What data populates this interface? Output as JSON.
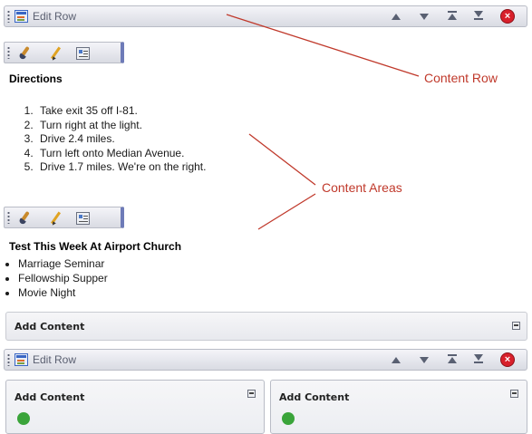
{
  "rows": [
    {
      "label": "Edit Row"
    },
    {
      "label": "Edit Row"
    }
  ],
  "content_areas": [
    {
      "heading": "Directions",
      "items": [
        "Take exit 35 off I-81.",
        "Turn right at the light.",
        "Drive 2.4 miles.",
        "Turn left onto Median Avenue.",
        "Drive 1.7 miles. We're on the right."
      ]
    },
    {
      "heading": "Test This Week At Airport Church",
      "items": [
        "Marriage Seminar",
        "Fellowship Supper",
        "Movie Night"
      ]
    }
  ],
  "add_content": {
    "label": "Add Content",
    "columns": [
      "Add Content",
      "Add Content"
    ]
  },
  "annotations": {
    "content_row": "Content Row",
    "content_areas": "Content Areas"
  },
  "colors": {
    "annotation": "#c0392b",
    "bar_gradient_top": "#f4f4f8",
    "bar_gradient_bottom": "#d9dbe3",
    "close": "#d8202b"
  },
  "icons": [
    "grip-icon",
    "edit-row-icon",
    "move-up-icon",
    "move-down-icon",
    "move-top-icon",
    "move-bottom-icon",
    "close-icon",
    "brush-icon",
    "pencil-icon",
    "properties-icon",
    "collapse-icon"
  ]
}
